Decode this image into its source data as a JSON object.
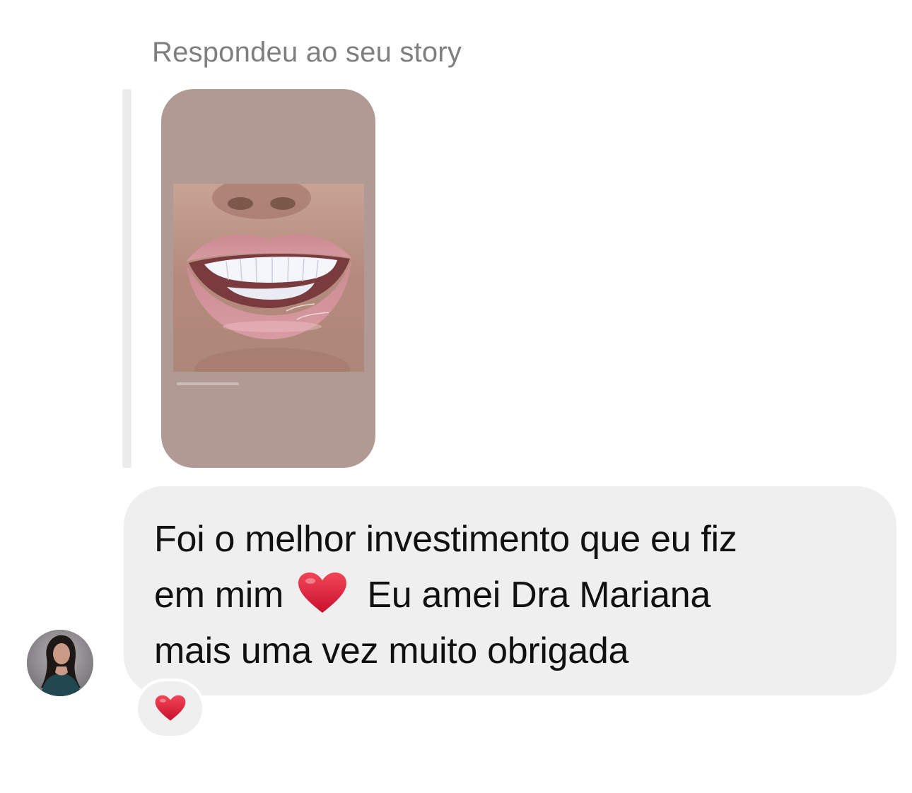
{
  "story_reply": {
    "label": "Respondeu ao seu story",
    "story_thumbnail_icon": "smile-photo"
  },
  "message": {
    "line1": "Foi o melhor investimento que eu fiz",
    "line2_before": "em mim",
    "line2_emoji": "red-heart-icon",
    "line2_after": "Eu amei Dra Mariana",
    "line3": "mais uma vez muito obrigada"
  },
  "reaction": {
    "emoji": "red-heart-icon"
  },
  "colors": {
    "bubble": "#efefef",
    "label_gray": "#7f7f7f",
    "heart_red": "#e8263a",
    "story_bg": "#b09a93"
  }
}
